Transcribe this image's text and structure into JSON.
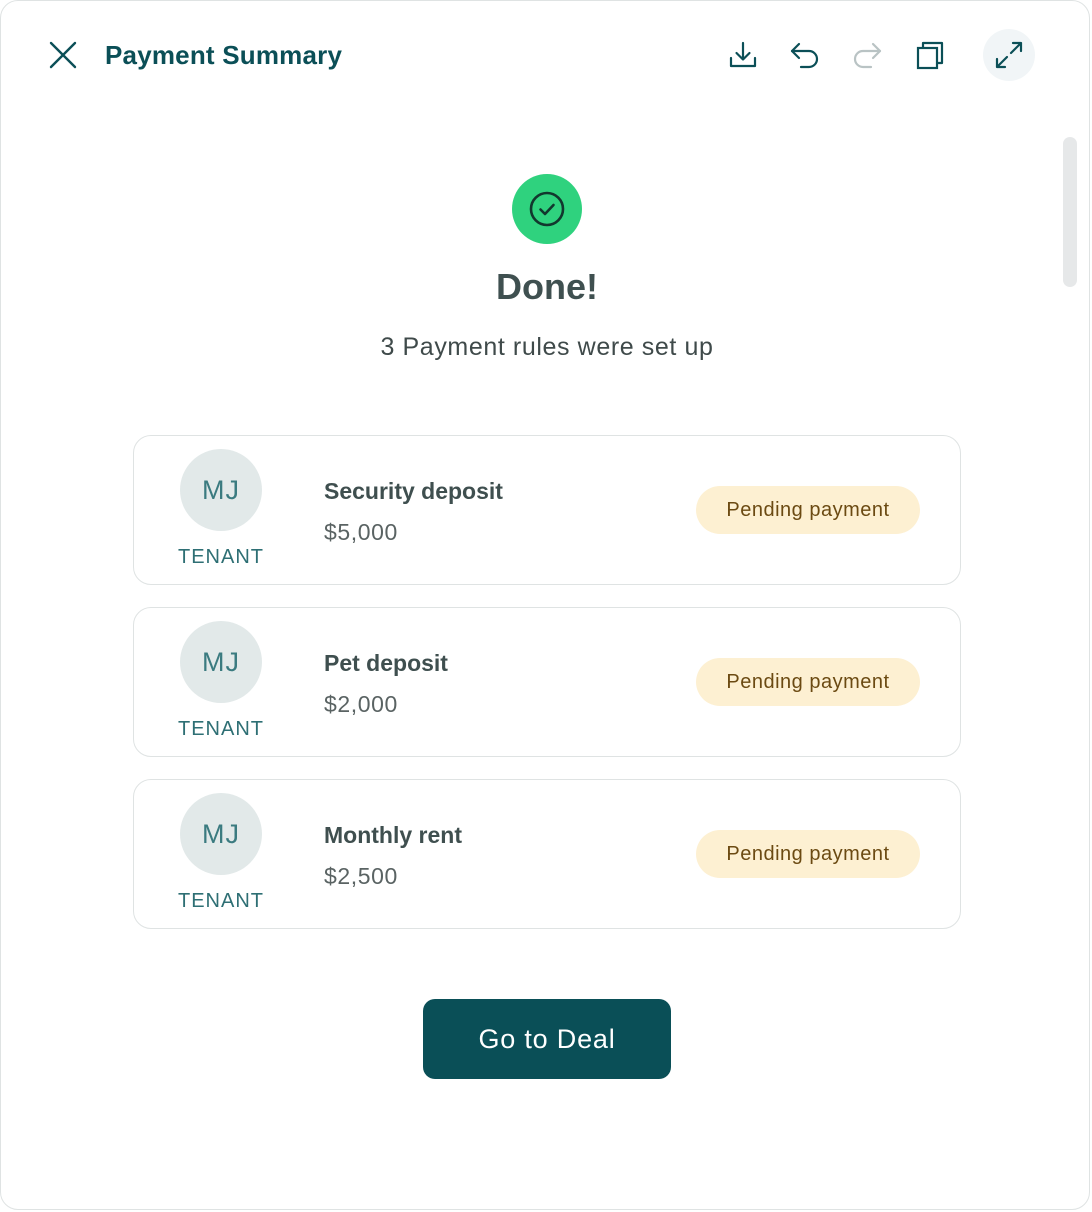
{
  "header": {
    "title": "Payment Summary",
    "icons": {
      "close": "close-icon",
      "download": "download-icon",
      "undo": "undo-icon",
      "redo": "redo-icon",
      "copy": "copy-icon",
      "expand": "expand-icon"
    }
  },
  "success": {
    "icon": "check-circle-icon",
    "title": "Done!",
    "subtitle": "3 Payment rules were set up"
  },
  "rules": [
    {
      "initials": "MJ",
      "role": "TENANT",
      "name": "Security deposit",
      "amount": "$5,000",
      "status": "Pending payment"
    },
    {
      "initials": "MJ",
      "role": "TENANT",
      "name": "Pet deposit",
      "amount": "$2,000",
      "status": "Pending payment"
    },
    {
      "initials": "MJ",
      "role": "TENANT",
      "name": "Monthly rent",
      "amount": "$2,500",
      "status": "Pending payment"
    }
  ],
  "actions": {
    "primary_label": "Go to Deal"
  },
  "colors": {
    "brand": "#0a4f57",
    "success": "#2fd27e",
    "pending_bg": "#fdf0d2",
    "pending_text": "#6b4a12"
  }
}
